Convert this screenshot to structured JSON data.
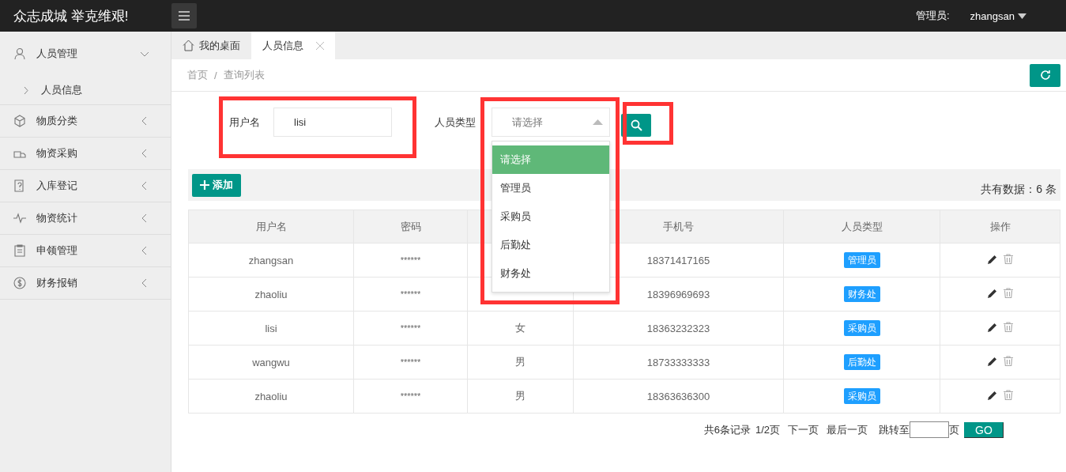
{
  "header": {
    "logo": "众志成城 举克维艰!",
    "user_label": "管理员:",
    "user_name": "zhangsan"
  },
  "sidebar": {
    "items": [
      {
        "label": "人员管理",
        "expanded": true,
        "children": [
          {
            "label": "人员信息"
          }
        ]
      },
      {
        "label": "物质分类",
        "expanded": false
      },
      {
        "label": "物资采购",
        "expanded": false
      },
      {
        "label": "入库登记",
        "expanded": false
      },
      {
        "label": "物资统计",
        "expanded": false
      },
      {
        "label": "申领管理",
        "expanded": false
      },
      {
        "label": "财务报销",
        "expanded": false
      }
    ]
  },
  "tabs": [
    {
      "label": "我的桌面",
      "selected": false,
      "closable": false
    },
    {
      "label": "人员信息",
      "selected": true,
      "closable": true
    }
  ],
  "breadcrumb": {
    "separator": "/",
    "items": [
      "首页",
      "查询列表"
    ]
  },
  "search": {
    "username_label": "用户名",
    "username_value": "lisi",
    "type_label": "人员类型",
    "type_placeholder": "请选择",
    "options": [
      {
        "label": "请选择",
        "selected": true
      },
      {
        "label": "管理员",
        "selected": false
      },
      {
        "label": "采购员",
        "selected": false
      },
      {
        "label": "后勤处",
        "selected": false
      },
      {
        "label": "财务处",
        "selected": false
      }
    ]
  },
  "toolbar": {
    "add_button": "添加",
    "total": "共有数据：6 条"
  },
  "table": {
    "columns": [
      {
        "label": "用户名"
      },
      {
        "label": "密码"
      },
      {},
      {
        "label": "手机号"
      },
      {
        "label": "人员类型"
      },
      {
        "label": "操作"
      }
    ],
    "rows": [
      {
        "username": "zhangsan",
        "password": "******",
        "phone": "18371417165",
        "type": "管理员"
      },
      {
        "username": "zhaoliu",
        "password": "******",
        "phone": "18396969693",
        "type": "财务处"
      },
      {
        "username": "lisi",
        "password": "******",
        "gender": "女",
        "phone": "18363232323",
        "type": "采购员"
      },
      {
        "username": "wangwu",
        "password": "******",
        "gender": "男",
        "phone": "18733333333",
        "type": "后勤处"
      },
      {
        "username": "zhaoliu",
        "password": "******",
        "gender": "男",
        "phone": "18363636300",
        "type": "采购员"
      }
    ]
  },
  "pagination": {
    "summary": "共6条记录",
    "page": "1/2页",
    "next": "下一页",
    "last": "最后一页",
    "jump_label": "跳转至",
    "page_unit": "页",
    "go": "GO"
  }
}
